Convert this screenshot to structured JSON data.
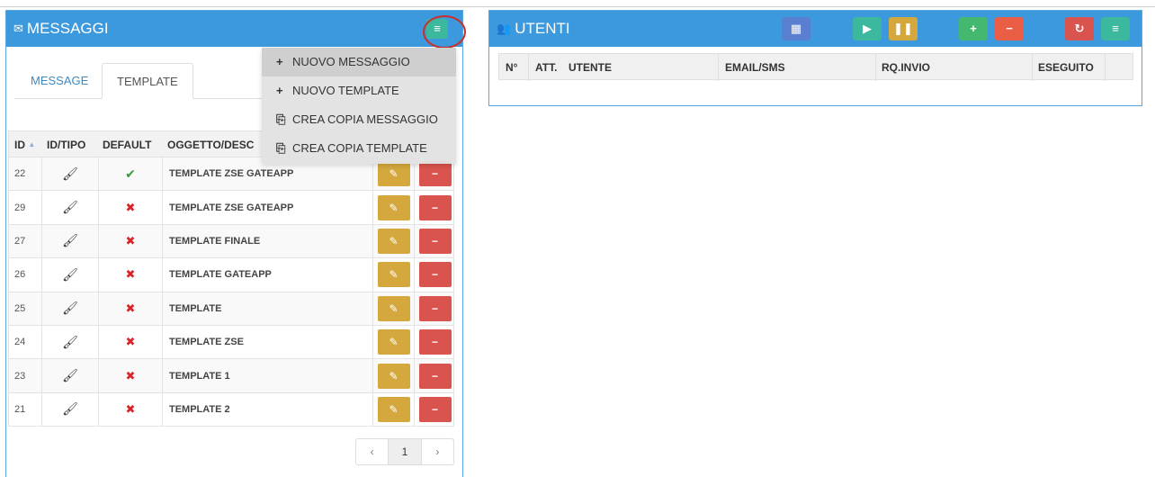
{
  "messages_panel": {
    "title": "MESSAGGI",
    "icon": "envelope-icon",
    "menu_icon": "≡",
    "tabs": [
      {
        "label": "MESSAGE"
      },
      {
        "label": "TEMPLATE"
      }
    ],
    "dropdown": [
      {
        "icon": "+",
        "label": "NUOVO MESSAGGIO"
      },
      {
        "icon": "+",
        "label": "NUOVO TEMPLATE"
      },
      {
        "icon": "⎘",
        "label": "CREA COPIA MESSAGGIO"
      },
      {
        "icon": "⎘",
        "label": "CREA COPIA TEMPLATE"
      }
    ],
    "columns": {
      "id": "ID",
      "sort_icon": "▲",
      "tipo": "ID/TIPO",
      "default": "DEFAULT",
      "subject": "OGGETTO/DESC"
    },
    "rows": [
      {
        "id": "22",
        "default": true,
        "subject": "TEMPLATE ZSE GATEAPP"
      },
      {
        "id": "29",
        "default": false,
        "subject": "TEMPLATE ZSE GATEAPP"
      },
      {
        "id": "27",
        "default": false,
        "subject": "TEMPLATE FINALE"
      },
      {
        "id": "26",
        "default": false,
        "subject": "TEMPLATE GATEAPP"
      },
      {
        "id": "25",
        "default": false,
        "subject": "TEMPLATE"
      },
      {
        "id": "24",
        "default": false,
        "subject": "TEMPLATE ZSE"
      },
      {
        "id": "23",
        "default": false,
        "subject": "TEMPLATE 1"
      },
      {
        "id": "21",
        "default": false,
        "subject": "TEMPLATE 2"
      }
    ],
    "pagination": {
      "prev": "‹",
      "current": "1",
      "next": "›"
    }
  },
  "users_panel": {
    "title": "UTENTI",
    "icon": "users-icon",
    "toolbar": [
      {
        "name": "grid-button",
        "icon": "▦",
        "color": "#5a7ed0"
      },
      {
        "name": "play-button",
        "icon": "▶",
        "color": "#3bb89d"
      },
      {
        "name": "pause-button",
        "icon": "❚❚",
        "color": "#d4a83d"
      },
      {
        "name": "add-button",
        "icon": "+",
        "color": "#45b86f"
      },
      {
        "name": "remove-button",
        "icon": "−",
        "color": "#e95e45"
      },
      {
        "name": "refresh-button",
        "icon": "↻",
        "color": "#d9534f"
      },
      {
        "name": "menu-button",
        "icon": "≡",
        "color": "#3bb89d"
      }
    ],
    "columns": [
      "N°",
      "ATT.",
      "UTENTE",
      "EMAIL/SMS",
      "RQ.INVIO",
      "ESEGUITO"
    ]
  },
  "colors": {
    "header_blue": "#3c99dd",
    "edit_gold": "#d4a83d",
    "delete_red": "#d9534f",
    "check_green": "#3c9a3c",
    "cross_red": "#d9252a"
  }
}
